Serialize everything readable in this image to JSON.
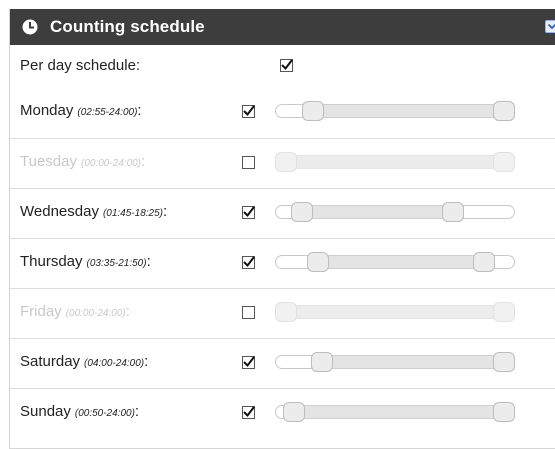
{
  "panel": {
    "title": "Counting schedule",
    "title_icon": "clock-icon",
    "collapse_icon": "chevron-down-icon",
    "header_bg": "#3d3d3d"
  },
  "per_day": {
    "label": "Per day schedule:",
    "checked": true
  },
  "days": [
    {
      "id": "monday",
      "day": "Monday",
      "range": "(02:55-24:00)",
      "enabled": true,
      "start_frac": 0.122,
      "end_frac": 1.0
    },
    {
      "id": "tuesday",
      "day": "Tuesday",
      "range": "(00:00-24:00)",
      "enabled": false,
      "start_frac": 0.0,
      "end_frac": 1.0
    },
    {
      "id": "wednesday",
      "day": "Wednesday",
      "range": "(01:45-18:25)",
      "enabled": true,
      "start_frac": 0.073,
      "end_frac": 0.767
    },
    {
      "id": "thursday",
      "day": "Thursday",
      "range": "(03:35-21:50)",
      "enabled": true,
      "start_frac": 0.149,
      "end_frac": 0.91
    },
    {
      "id": "friday",
      "day": "Friday",
      "range": "(00:00-24:00)",
      "enabled": false,
      "start_frac": 0.0,
      "end_frac": 1.0
    },
    {
      "id": "saturday",
      "day": "Saturday",
      "range": "(04:00-24:00)",
      "enabled": true,
      "start_frac": 0.167,
      "end_frac": 1.0
    },
    {
      "id": "sunday",
      "day": "Sunday",
      "range": "(00:50-24:00)",
      "enabled": true,
      "start_frac": 0.035,
      "end_frac": 1.0
    }
  ],
  "colors": {
    "disabled_text": "#c8c8c8",
    "slider_fill": "#e4e4e4",
    "handle": "#ececec"
  }
}
